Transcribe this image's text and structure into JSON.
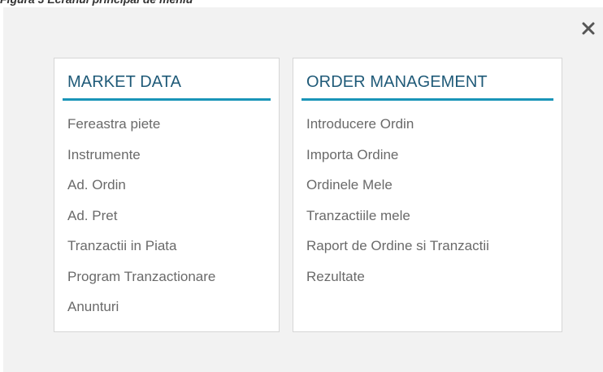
{
  "caption": "Figura 3 Ecranul principal de meniu",
  "close_label": "Close",
  "market_data": {
    "title": "MARKET DATA",
    "items": [
      "Fereastra piete",
      "Instrumente",
      "Ad. Ordin",
      "Ad. Pret",
      "Tranzactii in Piata",
      "Program Tranzactionare",
      "Anunturi"
    ]
  },
  "order_management": {
    "title": "ORDER MANAGEMENT",
    "items": [
      "Introducere Ordin",
      "Importa Ordine",
      "Ordinele Mele",
      "Tranzactiile mele",
      "Raport de Ordine si Tranzactii",
      "Rezultate"
    ]
  },
  "colors": {
    "accent": "#1a95b8",
    "title_text": "#1f5a78",
    "item_text": "#6a6a6a",
    "overlay_bg": "#f2f2f2"
  }
}
